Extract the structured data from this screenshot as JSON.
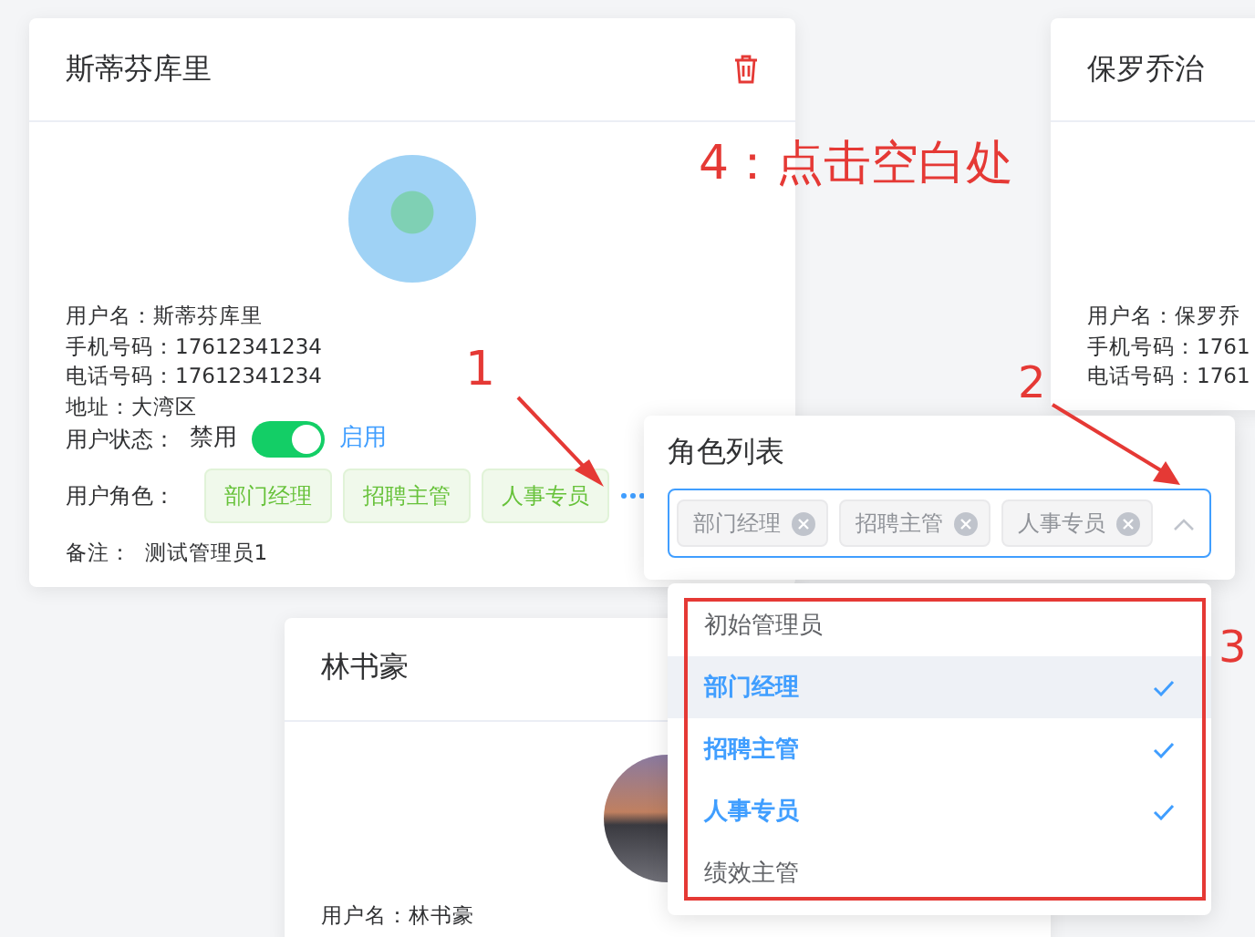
{
  "cards": [
    {
      "title": "斯蒂芬库里",
      "avatar": {
        "kind": "illustration"
      },
      "info": [
        "用户名：斯蒂芬库里",
        "手机号码：17612341234",
        "电话号码：17612341234",
        "地址：大湾区"
      ],
      "status": {
        "label": "用户状态：",
        "off_label": "禁用",
        "on_label": "启用",
        "on": true
      },
      "roles": {
        "label": "用户角色：",
        "tags": [
          "部门经理",
          "招聘主管",
          "人事专员"
        ]
      },
      "remark": "备注：  测试管理员1"
    },
    {
      "title": "保罗乔治",
      "info": [
        "用户名：保罗乔",
        "手机号码：1761",
        "电话号码：1761"
      ]
    },
    {
      "title": "林书豪",
      "avatar": {
        "kind": "photo"
      },
      "info": [
        "用户名：林书豪"
      ]
    }
  ],
  "role_popover": {
    "title": "角色列表",
    "selected_tags": [
      "部门经理",
      "招聘主管",
      "人事专员"
    ],
    "expanded": true,
    "options": [
      {
        "label": "初始管理员",
        "selected": false,
        "hovered": false
      },
      {
        "label": "部门经理",
        "selected": true,
        "hovered": true
      },
      {
        "label": "招聘主管",
        "selected": true,
        "hovered": false
      },
      {
        "label": "人事专员",
        "selected": true,
        "hovered": false
      },
      {
        "label": "绩效主管",
        "selected": false,
        "hovered": false
      }
    ]
  },
  "annotations": [
    {
      "kind": "step",
      "text": "1"
    },
    {
      "kind": "step",
      "text": "2"
    },
    {
      "kind": "step",
      "text": "3"
    },
    {
      "kind": "note",
      "text": "4：点击空白处"
    }
  ]
}
